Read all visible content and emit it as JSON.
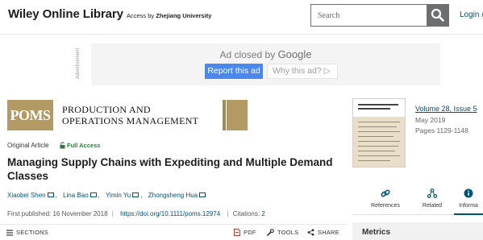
{
  "header": {
    "brand": "Wiley Online Library",
    "access_prefix": "Access by",
    "institution": "Zhejiang University",
    "search_placeholder": "Search",
    "search_icon": "search-icon",
    "login": "Login /"
  },
  "ad": {
    "vertical_label": "Advertisement",
    "closed_text": "Ad closed by",
    "closed_brand": "Google",
    "report_label": "Report this ad",
    "why_label": "Why this ad? ▷"
  },
  "journal": {
    "logo_text": "POMS",
    "title_line1": "PRODUCTION AND",
    "title_line2": "OPERATIONS MANAGEMENT"
  },
  "article": {
    "type": "Original Article",
    "access": "Full Access",
    "title": "Managing Supply Chains with Expediting and Multiple Demand Classes",
    "authors": [
      "Xiaobei Shen",
      "Lina Bao",
      "Yimin Yu",
      "Zhongsheng Hua"
    ],
    "first_published_label": "First published:",
    "first_published_date": "16 November 2018",
    "doi": "https://doi.org/10.1111/poms.12974",
    "citations_label": "Citations:",
    "citations_count": "2"
  },
  "toolbar": {
    "sections": "SECTIONS",
    "pdf": "PDF",
    "tools": "TOOLS",
    "share": "SHARE"
  },
  "issue": {
    "volume": "Volume 28, Issue 5",
    "date": "May 2019",
    "pages": "Pages 1129-1148"
  },
  "rail_tabs": [
    {
      "label": "References",
      "icon": "link-icon"
    },
    {
      "label": "Related",
      "icon": "network-icon"
    },
    {
      "label": "Informa",
      "icon": "info-icon"
    }
  ],
  "metrics_label": "Metrics",
  "colors": {
    "link": "#005274",
    "poms_gold": "#b39a63",
    "ad_button": "#4a88ee",
    "search_button": "#6d6e70",
    "full_access": "#2f7a3b"
  }
}
